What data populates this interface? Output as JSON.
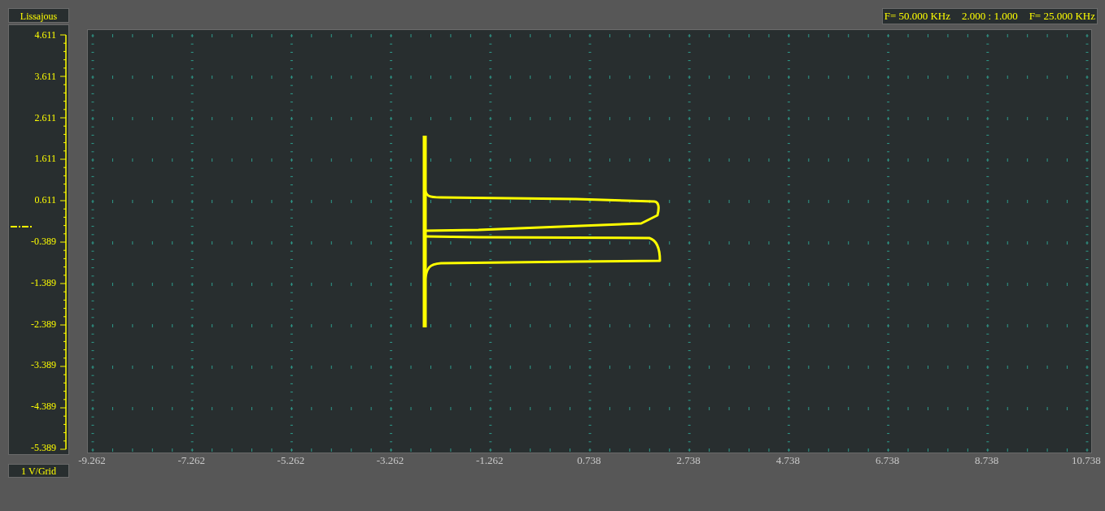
{
  "panel": {
    "title": "Lissajous",
    "scale": "1 V/Grid"
  },
  "y_labels": [
    "4.611",
    "3.611",
    "2.611",
    "1.611",
    "0.611",
    "-0.389",
    "-1.389",
    "-2.389",
    "-3.389",
    "-4.389",
    "-5.389"
  ],
  "info": [
    "F= 50.000 KHz",
    "2.000 : 1.000",
    "F= 25.000 KHz"
  ],
  "x_labels": [
    "-9.262",
    "-7.262",
    "-5.262",
    "-3.262",
    "-1.262",
    "0.738",
    "2.738",
    "4.738",
    "6.738",
    "8.738",
    "10.738"
  ]
}
